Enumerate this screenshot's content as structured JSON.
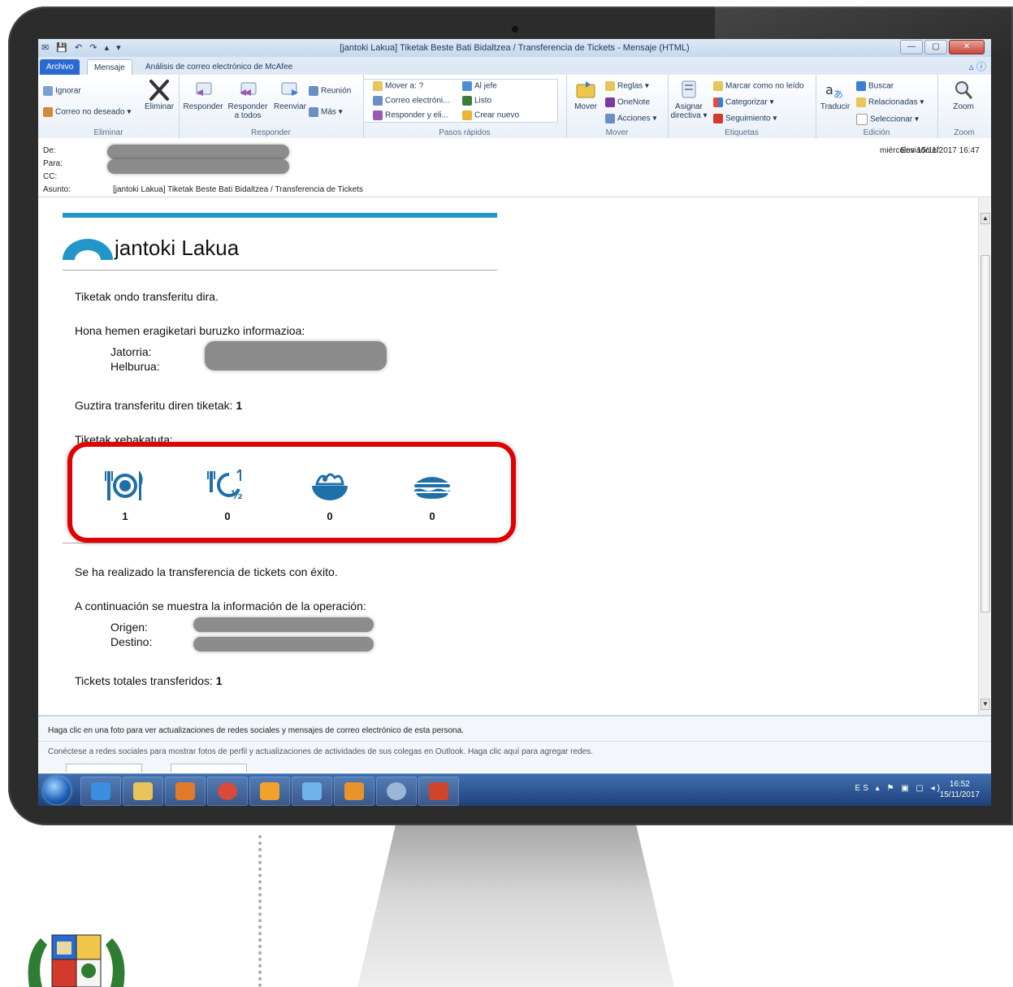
{
  "window": {
    "title": "[jantoki Lakua] Tiketak Beste Bati Bidaltzea / Transferencia de Tickets - Mensaje (HTML)"
  },
  "tabs": [
    {
      "label": "Archivo"
    },
    {
      "label": "Mensaje"
    },
    {
      "label": "Análisis de correo electrónico de McAfee"
    }
  ],
  "ribbon": {
    "eliminar": {
      "ignorar": "Ignorar",
      "correo_no_deseado": "Correo no deseado ▾",
      "eliminar": "Eliminar",
      "group": "Eliminar"
    },
    "responder": {
      "responder": "Responder",
      "responder_todos": "Responder a todos",
      "reenviar": "Reenviar",
      "reunion": "Reunión",
      "mas": "Más ▾",
      "group": "Responder"
    },
    "pasos": {
      "mover_a": "Mover a: ?",
      "al_jefe": "Al jefe",
      "correo": "Correo electróni...",
      "listo": "Listo",
      "responder_eli": "Responder y eli...",
      "crear_nuevo": "Crear nuevo",
      "group": "Pasos rápidos"
    },
    "mover": {
      "mover": "Mover",
      "reglas": "Reglas ▾",
      "onenote": "OneNote",
      "acciones": "Acciones ▾",
      "group": "Mover"
    },
    "etiquetas": {
      "asignar": "Asignar directiva ▾",
      "marcar": "Marcar como no leído",
      "categorizar": "Categorizar ▾",
      "seguimiento": "Seguimiento ▾",
      "group": "Etiquetas"
    },
    "edicion": {
      "traducir": "Traducir",
      "buscar": "Buscar",
      "relacionadas": "Relacionadas ▾",
      "seleccionar": "Seleccionar ▾",
      "group": "Edición"
    },
    "zoom": {
      "zoom": "Zoom",
      "group": "Zoom"
    }
  },
  "header": {
    "de_label": "De:",
    "para_label": "Para:",
    "cc_label": "CC:",
    "asunto_label": "Asunto:",
    "asunto": "[jantoki Lakua] Tiketak Beste Bati Bidaltzea / Transferencia de Tickets",
    "enviado_label": "Enviado el:",
    "enviado": "miércoles 15/11/2017 16:47"
  },
  "mail": {
    "logo_word": "jantoki",
    "logo_word2": "Lakua",
    "eu_intro": "Tiketak ondo transferitu dira.",
    "eu_info": "Hona hemen eragiketari buruzko informazioa:",
    "eu_origin_label": "Jatorria:",
    "eu_dest_label": "Helburua:",
    "eu_total_label": "Guztira transferitu diren tiketak:",
    "eu_total": "1",
    "eu_broken_label": "Tiketak xehakatuta:",
    "tickets": [
      {
        "icon": "plate-cutlery-icon",
        "count": "1"
      },
      {
        "icon": "half-menu-icon",
        "count": "0"
      },
      {
        "icon": "salad-bowl-icon",
        "count": "0"
      },
      {
        "icon": "sandwich-icon",
        "count": "0"
      }
    ],
    "es_intro": "Se ha realizado la transferencia de tickets con éxito.",
    "es_info": "A continuación se muestra la información de la operación:",
    "es_origin_label": "Origen:",
    "es_dest_label": "Destino:",
    "es_total_label": "Tickets totales transferidos:",
    "es_total": "1"
  },
  "people_pane": {
    "line1": "Haga clic en una foto para ver actualizaciones de redes sociales y mensajes de correo electrónico de esta persona.",
    "line2": "Conéctese a redes sociales para mostrar fotos de perfil y actualizaciones de actividades de sus colegas en Outlook. Haga clic aquí para agregar redes."
  },
  "taskbar": {
    "lang": "ES",
    "time": "16:52",
    "date": "15/11/2017"
  },
  "colors": {
    "brand": "#2296c6",
    "highlight": "#e00000",
    "taskbar": "#1d3f78"
  }
}
